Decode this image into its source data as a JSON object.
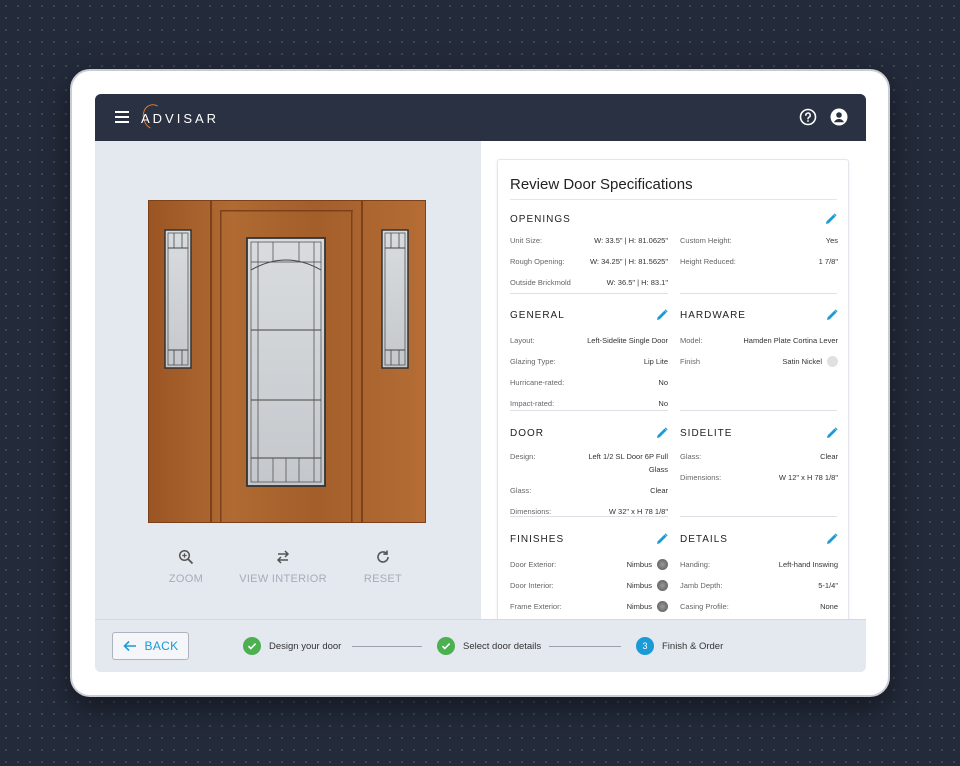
{
  "app": {
    "brand": "ADVISAR"
  },
  "header": {
    "menu_icon": "hamburger-menu-icon",
    "help_icon": "help-icon",
    "user_icon": "user-icon"
  },
  "toolbar": {
    "zoom": "ZOOM",
    "view_interior": "VIEW INTERIOR",
    "reset": "RESET"
  },
  "specs": {
    "title": "Review Door Specifications",
    "openings": {
      "title": "OPENINGS",
      "left": [
        {
          "label": "Unit Size:",
          "value": "W: 33.5\" | H: 81.0625\""
        },
        {
          "label": "Rough Opening:",
          "value": "W: 34.25\" | H: 81.5625\""
        },
        {
          "label": "Outside Brickmold",
          "value": "W: 36.5\" | H: 83.1\""
        }
      ],
      "right": [
        {
          "label": "Custom Height:",
          "value": "Yes"
        },
        {
          "label": "Height Reduced:",
          "value": "1 7/8\""
        }
      ]
    },
    "general": {
      "title": "GENERAL",
      "rows": [
        {
          "label": "Layout:",
          "value": "Left-Sidelite Single Door"
        },
        {
          "label": "Glazing Type:",
          "value": "Lip Lite"
        },
        {
          "label": "Hurricane-rated:",
          "value": "No"
        },
        {
          "label": "Impact-rated:",
          "value": "No"
        }
      ]
    },
    "hardware": {
      "title": "HARDWARE",
      "rows": [
        {
          "label": "Model:",
          "value": "Hamden Plate Cortina Lever"
        },
        {
          "label": "Finish",
          "value": "Satin Nickel"
        }
      ]
    },
    "door": {
      "title": "DOOR",
      "rows": [
        {
          "label": "Design:",
          "value": "Left 1/2 SL Door 6P Full Glass"
        },
        {
          "label": "Glass:",
          "value": "Clear"
        },
        {
          "label": "Dimensions:",
          "value": "W 32\" x H 78 1/8\""
        }
      ]
    },
    "sidelite": {
      "title": "SIDELITE",
      "rows": [
        {
          "label": "Glass:",
          "value": "Clear"
        },
        {
          "label": "Dimensions:",
          "value": "W 12\" x H 78 1/8\""
        }
      ]
    },
    "finishes": {
      "title": "FINISHES",
      "rows": [
        {
          "label": "Door Exterior:",
          "value": "Nimbus"
        },
        {
          "label": "Door Interior:",
          "value": "Nimbus"
        },
        {
          "label": "Frame Exterior:",
          "value": "Nimbus"
        }
      ]
    },
    "details": {
      "title": "DETAILS",
      "rows": [
        {
          "label": "Handing:",
          "value": "Left-hand Inswing"
        },
        {
          "label": "Jamb Depth:",
          "value": "5-1/4\""
        },
        {
          "label": "Casing Profile:",
          "value": "None"
        }
      ]
    }
  },
  "footer": {
    "back": "BACK",
    "steps": [
      {
        "label": "Design your door",
        "state": "done"
      },
      {
        "label": "Select door details",
        "state": "done"
      },
      {
        "number": "3",
        "label": "Finish & Order",
        "state": "active"
      }
    ]
  },
  "colors": {
    "accent": "#1a9ad6",
    "done": "#4caf50",
    "header_bg": "#2a3142",
    "brand_arc": "#e07a2a"
  }
}
